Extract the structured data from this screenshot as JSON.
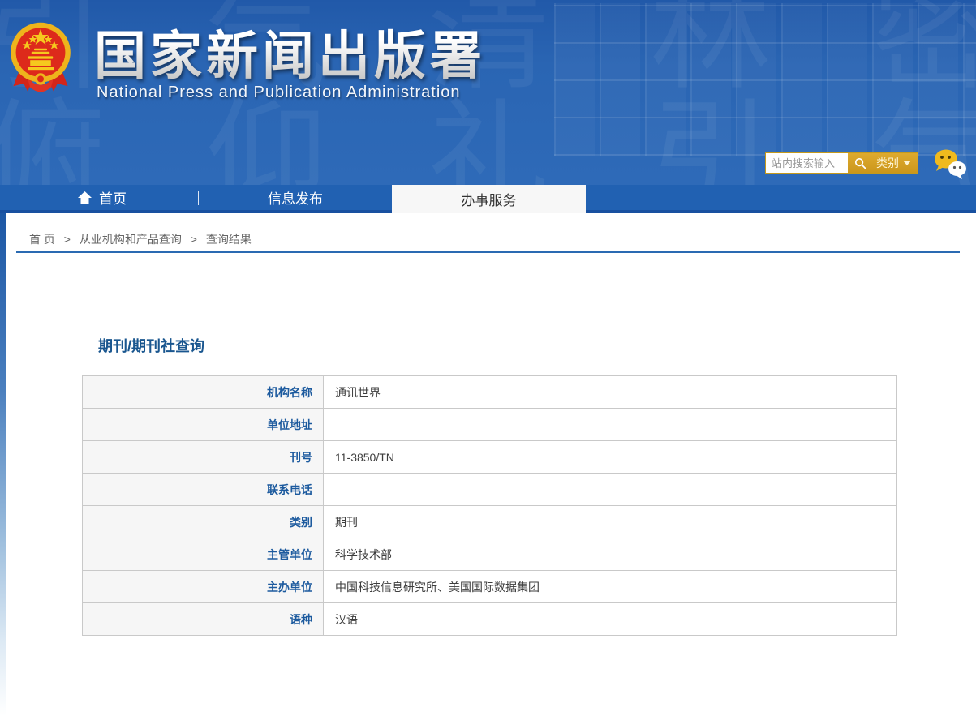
{
  "header": {
    "title": "国家新闻出版署",
    "subtitle": "National  Press and Publication Administration",
    "decor_glyphs": "引 气 清 林 密 俯 仰 礼 引 气 清 林 密 俯 仰",
    "search": {
      "placeholder": "站内搜索输入",
      "category": "类别"
    }
  },
  "nav": {
    "items": [
      {
        "label": "首页"
      },
      {
        "label": "信息发布"
      },
      {
        "label": "办事服务",
        "active": true
      }
    ]
  },
  "breadcrumb": {
    "separator": ">",
    "items": [
      "首 页",
      "从业机构和产品查询",
      "查询结果"
    ]
  },
  "main": {
    "title": "期刊/期刊社查询",
    "table": {
      "rows": [
        {
          "label": "机构名称",
          "value": "通讯世界"
        },
        {
          "label": "单位地址",
          "value": ""
        },
        {
          "label": "刊号",
          "value": "11-3850/TN"
        },
        {
          "label": "联系电话",
          "value": ""
        },
        {
          "label": "类别",
          "value": "期刊"
        },
        {
          "label": "主管单位",
          "value": "科学技术部"
        },
        {
          "label": "主办单位",
          "value": "中国科技信息研究所、美国国际数据集团"
        },
        {
          "label": "语种",
          "value": "汉语"
        }
      ]
    }
  },
  "colors": {
    "header_blue": "#2a65b3",
    "nav_blue": "#2161b2",
    "nav_border_blue": "#1850a0",
    "accent_blue": "#1c5a9e",
    "gold": "#cc971c",
    "divider_blue": "#2a6ab2",
    "label_bg": "#f6f6f6",
    "table_border": "#c9c9c9"
  }
}
